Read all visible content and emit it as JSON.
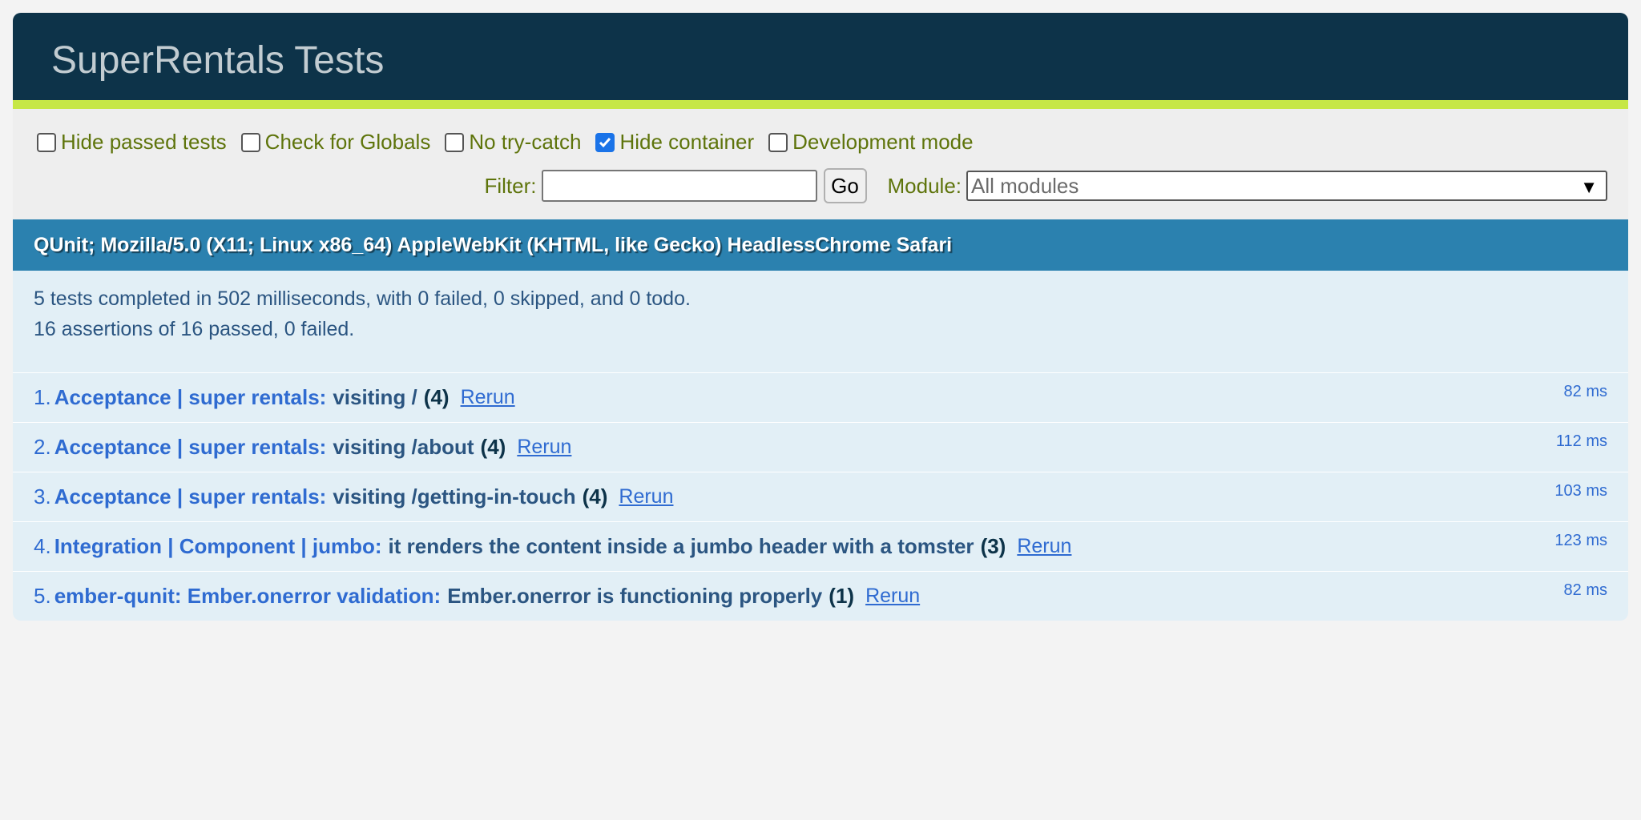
{
  "header": {
    "title": "SuperRentals Tests"
  },
  "toolbar": {
    "options": [
      {
        "label": "Hide passed tests",
        "checked": false
      },
      {
        "label": "Check for Globals",
        "checked": false
      },
      {
        "label": "No try-catch",
        "checked": false
      },
      {
        "label": "Hide container",
        "checked": true
      },
      {
        "label": "Development mode",
        "checked": false
      }
    ],
    "filter_label": "Filter:",
    "filter_value": "",
    "go_label": "Go",
    "module_label": "Module:",
    "module_selected": "All modules"
  },
  "user_agent": "QUnit; Mozilla/5.0 (X11; Linux x86_64) AppleWebKit (KHTML, like Gecko) HeadlessChrome Safari",
  "summary": {
    "line1": "5 tests completed in 502 milliseconds, with 0 failed, 0 skipped, and 0 todo.",
    "line2": "16 assertions of 16 passed, 0 failed."
  },
  "tests": [
    {
      "num": "1.",
      "module": "Acceptance | super rentals:",
      "name": "visiting /",
      "counts": "(4)",
      "rerun": "Rerun",
      "runtime": "82 ms"
    },
    {
      "num": "2.",
      "module": "Acceptance | super rentals:",
      "name": "visiting /about",
      "counts": "(4)",
      "rerun": "Rerun",
      "runtime": "112 ms"
    },
    {
      "num": "3.",
      "module": "Acceptance | super rentals:",
      "name": "visiting /getting-in-touch",
      "counts": "(4)",
      "rerun": "Rerun",
      "runtime": "103 ms"
    },
    {
      "num": "4.",
      "module": "Integration | Component | jumbo:",
      "name": "it renders the content inside a jumbo header with a tomster",
      "counts": "(3)",
      "rerun": "Rerun",
      "runtime": "123 ms"
    },
    {
      "num": "5.",
      "module": "ember-qunit: Ember.onerror validation:",
      "name": "Ember.onerror is functioning properly",
      "counts": "(1)",
      "rerun": "Rerun",
      "runtime": "82 ms"
    }
  ],
  "colors": {
    "header_bg": "#0d3349",
    "header_accent": "#c6e746",
    "ua_bar": "#2b81af",
    "results_bg": "#e2eff6",
    "toolbar_text": "#5e740b"
  }
}
